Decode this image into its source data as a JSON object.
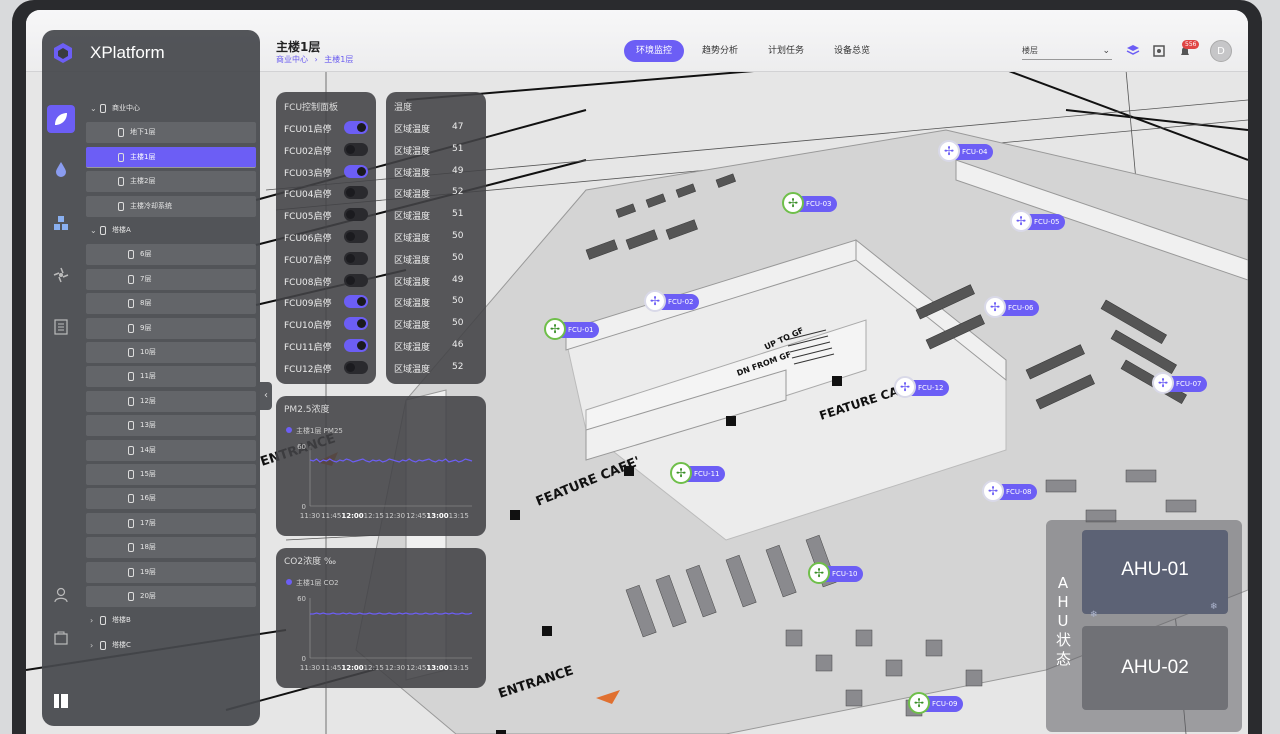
{
  "brand": "XPlatform",
  "header": {
    "title": "主楼1层",
    "breadcrumb": [
      "商业中心",
      "主楼1层"
    ],
    "tabs": [
      "环境监控",
      "趋势分析",
      "计划任务",
      "设备总览"
    ],
    "active_tab": 0,
    "select_value": "楼层",
    "notification_count": "556",
    "avatar": "D",
    "accent": "#6c5ef5"
  },
  "tree": [
    {
      "label": "商业中心",
      "level": 0,
      "expanded": true
    },
    {
      "label": "地下1层",
      "level": 1
    },
    {
      "label": "主楼1层",
      "level": 1,
      "selected": true
    },
    {
      "label": "主楼2层",
      "level": 1
    },
    {
      "label": "主楼冷却系统",
      "level": 1
    },
    {
      "label": "塔楼A",
      "level": 0,
      "expanded": true
    },
    {
      "label": "6层",
      "level": 2
    },
    {
      "label": "7层",
      "level": 2
    },
    {
      "label": "8层",
      "level": 2
    },
    {
      "label": "9层",
      "level": 2
    },
    {
      "label": "10层",
      "level": 2
    },
    {
      "label": "11层",
      "level": 2
    },
    {
      "label": "12层",
      "level": 2
    },
    {
      "label": "13层",
      "level": 2
    },
    {
      "label": "14层",
      "level": 2
    },
    {
      "label": "15层",
      "level": 2
    },
    {
      "label": "16层",
      "level": 2
    },
    {
      "label": "17层",
      "level": 2
    },
    {
      "label": "18层",
      "level": 2
    },
    {
      "label": "19层",
      "level": 2
    },
    {
      "label": "20层",
      "level": 2
    },
    {
      "label": "塔楼B",
      "level": 0
    },
    {
      "label": "塔楼C",
      "level": 0
    }
  ],
  "fcu_panel": {
    "title": "FCU控制面板",
    "items": [
      {
        "label": "FCU01启停",
        "on": true
      },
      {
        "label": "FCU02启停",
        "on": false
      },
      {
        "label": "FCU03启停",
        "on": true
      },
      {
        "label": "FCU04启停",
        "on": false
      },
      {
        "label": "FCU05启停",
        "on": false
      },
      {
        "label": "FCU06启停",
        "on": false
      },
      {
        "label": "FCU07启停",
        "on": false
      },
      {
        "label": "FCU08启停",
        "on": false
      },
      {
        "label": "FCU09启停",
        "on": true
      },
      {
        "label": "FCU10启停",
        "on": true
      },
      {
        "label": "FCU11启停",
        "on": true
      },
      {
        "label": "FCU12启停",
        "on": false
      }
    ]
  },
  "temp_panel": {
    "title": "温度",
    "items": [
      {
        "label": "区域温度",
        "value": "47"
      },
      {
        "label": "区域温度",
        "value": "51"
      },
      {
        "label": "区域温度",
        "value": "49"
      },
      {
        "label": "区域温度",
        "value": "52"
      },
      {
        "label": "区域温度",
        "value": "51"
      },
      {
        "label": "区域温度",
        "value": "50"
      },
      {
        "label": "区域温度",
        "value": "50"
      },
      {
        "label": "区域温度",
        "value": "49"
      },
      {
        "label": "区域温度",
        "value": "50"
      },
      {
        "label": "区域温度",
        "value": "50"
      },
      {
        "label": "区域温度",
        "value": "46"
      },
      {
        "label": "区域温度",
        "value": "52"
      }
    ]
  },
  "chart_data": [
    {
      "type": "line",
      "title": "PM2.5浓度",
      "series": [
        {
          "name": "主楼1层 PM25",
          "values": [
            46,
            45,
            47,
            44,
            46,
            45,
            47,
            45,
            44,
            46,
            45,
            47,
            46,
            44,
            45,
            46,
            47,
            45,
            44,
            46,
            45,
            46,
            44,
            45,
            47,
            46,
            45,
            44,
            46,
            45,
            47,
            45,
            44,
            46,
            45,
            46,
            47,
            45,
            44,
            46,
            45,
            47,
            44,
            45,
            46,
            44,
            45,
            47,
            46,
            45
          ]
        }
      ],
      "x_ticks": [
        "11:30",
        "11:45",
        "12:00",
        "12:15",
        "12:30",
        "12:45",
        "13:00",
        "13:15"
      ],
      "bold_ticks": [
        "12:00",
        "13:00"
      ],
      "ylim": [
        0,
        60
      ],
      "y_ticks": [
        "0",
        "60"
      ],
      "color": "#6c5ef5"
    },
    {
      "type": "line",
      "title": "CO2浓度 ‰",
      "series": [
        {
          "name": "主楼1层 CO2",
          "values": [
            44,
            44,
            45,
            44,
            45,
            44,
            44,
            45,
            44,
            44,
            45,
            44,
            45,
            44,
            44,
            45,
            44,
            44,
            45,
            44,
            44,
            45,
            44,
            44,
            45,
            44,
            44,
            45,
            44,
            45,
            44,
            44,
            45,
            44,
            44,
            45,
            44,
            44,
            45,
            44,
            44,
            45,
            44,
            45,
            44,
            44,
            45,
            44,
            44,
            45
          ]
        }
      ],
      "x_ticks": [
        "11:30",
        "11:45",
        "12:00",
        "12:15",
        "12:30",
        "12:45",
        "13:00",
        "13:15"
      ],
      "bold_ticks": [
        "12:00",
        "13:00"
      ],
      "ylim": [
        0,
        60
      ],
      "y_ticks": [
        "0",
        "60"
      ],
      "color": "#6c5ef5"
    }
  ],
  "fcu_tags": [
    {
      "label": "FCU-04",
      "green": false
    },
    {
      "label": "FCU-03",
      "green": true
    },
    {
      "label": "FCU-05",
      "green": false
    },
    {
      "label": "FCU-02",
      "green": false
    },
    {
      "label": "FCU-06",
      "green": false
    },
    {
      "label": "FCU-01",
      "green": true
    },
    {
      "label": "FCU-12",
      "green": false
    },
    {
      "label": "FCU-07",
      "green": false
    },
    {
      "label": "FCU-11",
      "green": true
    },
    {
      "label": "FCU-08",
      "green": false
    },
    {
      "label": "FCU-10",
      "green": true
    },
    {
      "label": "FCU-09",
      "green": true
    }
  ],
  "plan_labels": [
    "FEATURE CAFE'",
    "FEATURE CAFE'",
    "ENTRANCE",
    "ENTRANCE",
    "UP TO GF",
    "DN FROM GF"
  ],
  "ahu": {
    "section_label": "AHU状态",
    "units": [
      "AHU-01",
      "AHU-02"
    ]
  }
}
